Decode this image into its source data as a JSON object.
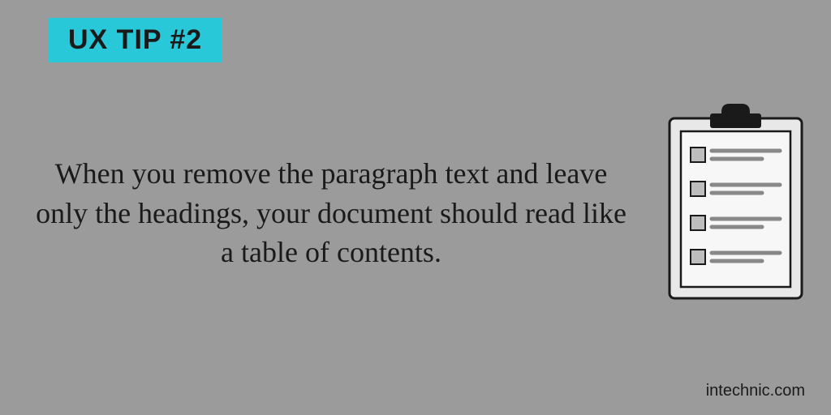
{
  "badge": {
    "label": "UX TIP #2"
  },
  "tip": {
    "text": "When you remove the paragraph text and leave only the headings, your document should read like a table of contents."
  },
  "attribution": {
    "text": "intechnic.com"
  },
  "icon": {
    "name": "clipboard-checklist-icon"
  }
}
